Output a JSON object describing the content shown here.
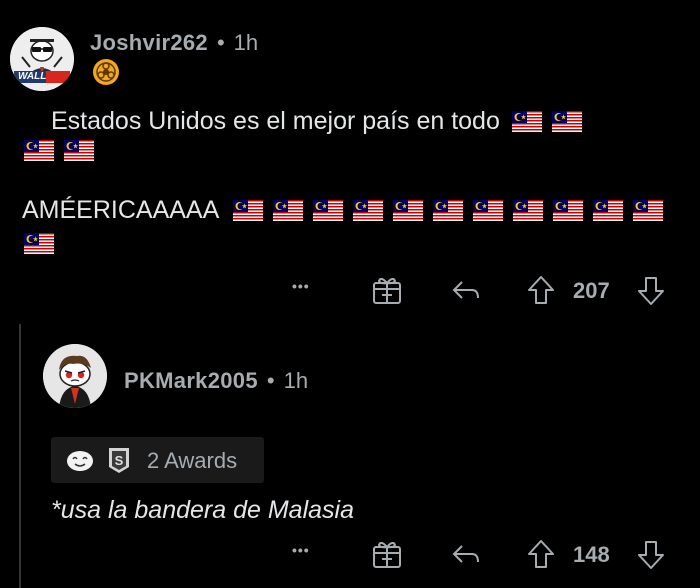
{
  "post": {
    "username": "Joshvir262",
    "separator": "•",
    "time": "1h",
    "avatar_label": "WALL",
    "flair_icon": "biohazard-icon",
    "line1": "Estados Unidos es el mejor país en todo",
    "line2": "AMÉERICAAAAA",
    "flag": "malaysia-flag-icon",
    "flag_counts": {
      "line1": 2,
      "line1_wrap": 2,
      "line2": 11,
      "line2_wrap": 1
    },
    "actions": {
      "more": "•••",
      "score": "207"
    }
  },
  "reply": {
    "username": "PKMark2005",
    "separator": "•",
    "time": "1h",
    "awards_label": "2 Awards",
    "text": "*usa la bandera de Malasia",
    "actions": {
      "more": "•••",
      "score": "148"
    }
  },
  "colors": {
    "background": "#000000",
    "meta_text": "#a6acb0",
    "body_text": "#e4e6e8",
    "flag_red": "#cc0001",
    "flag_blue": "#010066",
    "flag_yellow": "#ffcc00"
  }
}
